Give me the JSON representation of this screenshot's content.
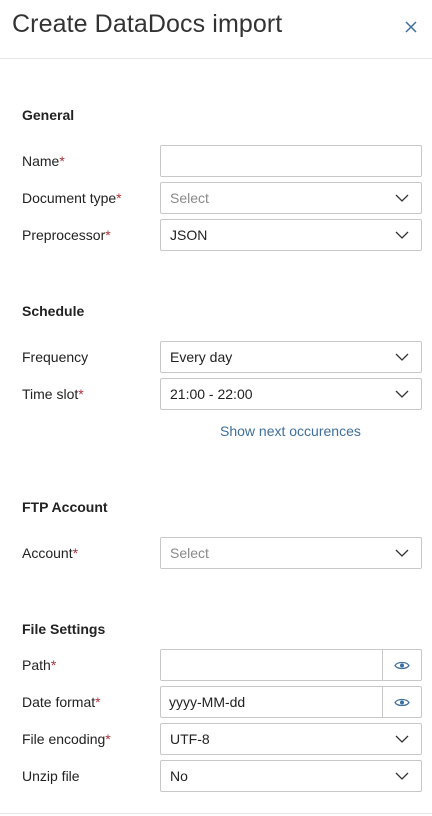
{
  "header": {
    "title": "Create DataDocs import"
  },
  "required_marker": "*",
  "sections": {
    "general": {
      "title": "General",
      "name": {
        "label": "Name",
        "value": ""
      },
      "document_type": {
        "label": "Document type",
        "value": "Select"
      },
      "preprocessor": {
        "label": "Preprocessor",
        "value": "JSON"
      }
    },
    "schedule": {
      "title": "Schedule",
      "frequency": {
        "label": "Frequency",
        "value": "Every day"
      },
      "time_slot": {
        "label": "Time slot",
        "value": "21:00 - 22:00"
      },
      "show_next_link": "Show next occurences"
    },
    "ftp": {
      "title": "FTP Account",
      "account": {
        "label": "Account",
        "value": "Select"
      }
    },
    "file_settings": {
      "title": "File Settings",
      "path": {
        "label": "Path",
        "value": ""
      },
      "date_format": {
        "label": "Date format",
        "value": "yyyy-MM-dd"
      },
      "file_encoding": {
        "label": "File encoding",
        "value": "UTF-8"
      },
      "unzip_file": {
        "label": "Unzip file",
        "value": "No"
      }
    }
  },
  "colors": {
    "required": "#b0313a",
    "link": "#3f6f9c",
    "border": "#c8c8c8",
    "icon": "#3f6f9c"
  },
  "icons": {
    "close": "close-icon",
    "chevron": "chevron-down-icon",
    "eye": "eye-icon"
  }
}
